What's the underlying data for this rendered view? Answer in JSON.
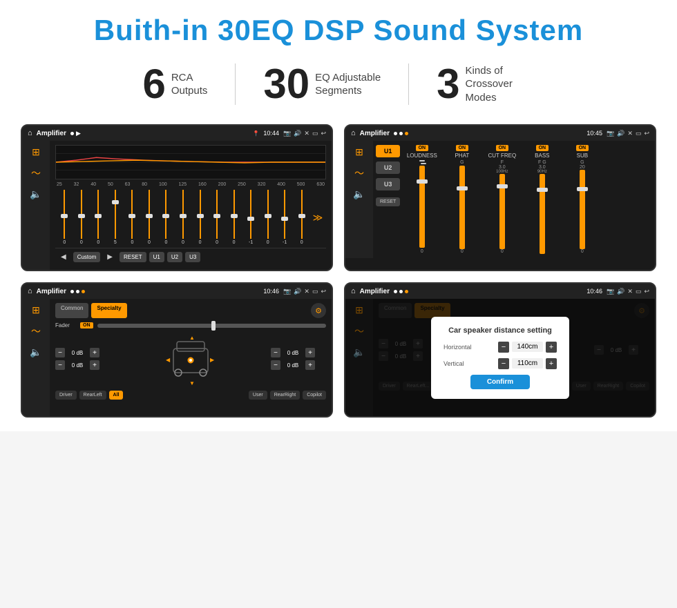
{
  "page": {
    "title": "Buith-in 30EQ DSP Sound System",
    "stats": [
      {
        "number": "6",
        "label": "RCA\nOutputs"
      },
      {
        "number": "30",
        "label": "EQ Adjustable\nSegments"
      },
      {
        "number": "3",
        "label": "Kinds of\nCrossover Modes"
      }
    ]
  },
  "screen1": {
    "topbar": {
      "title": "Amplifier",
      "time": "10:44",
      "mode": "▶"
    },
    "freqs": [
      "25",
      "32",
      "40",
      "50",
      "63",
      "80",
      "100",
      "125",
      "160",
      "200",
      "250",
      "320",
      "400",
      "500",
      "630"
    ],
    "values": [
      "0",
      "0",
      "0",
      "5",
      "0",
      "0",
      "0",
      "0",
      "0",
      "0",
      "0",
      "-1",
      "0",
      "-1"
    ],
    "buttons": [
      "Custom",
      "RESET",
      "U1",
      "U2",
      "U3"
    ]
  },
  "screen2": {
    "topbar": {
      "title": "Amplifier",
      "time": "10:45"
    },
    "uButtons": [
      "U1",
      "U2",
      "U3"
    ],
    "channels": [
      {
        "label": "LOUDNESS",
        "on": true
      },
      {
        "label": "PHAT",
        "on": true
      },
      {
        "label": "CUT FREQ",
        "on": true
      },
      {
        "label": "BASS",
        "on": true
      },
      {
        "label": "SUB",
        "on": true
      }
    ],
    "resetLabel": "RESET"
  },
  "screen3": {
    "topbar": {
      "title": "Amplifier",
      "time": "10:46"
    },
    "tabs": [
      "Common",
      "Specialty"
    ],
    "faderLabel": "Fader",
    "faderOn": "ON",
    "dbControls": [
      {
        "value": "0 dB"
      },
      {
        "value": "0 dB"
      },
      {
        "value": "0 dB"
      },
      {
        "value": "0 dB"
      }
    ],
    "bottomBtns": [
      "Driver",
      "RearLeft",
      "All",
      "User",
      "RearRight",
      "Copilot"
    ]
  },
  "screen4": {
    "topbar": {
      "title": "Amplifier",
      "time": "10:46"
    },
    "tabs": [
      "Common",
      "Specialty"
    ],
    "dialog": {
      "title": "Car speaker distance setting",
      "horizontal": {
        "label": "Horizontal",
        "value": "140cm"
      },
      "vertical": {
        "label": "Vertical",
        "value": "110cm"
      },
      "confirmLabel": "Confirm"
    },
    "dbControls": [
      {
        "value": "0 dB"
      },
      {
        "value": "0 dB"
      }
    ],
    "bottomBtns": [
      "Driver",
      "RearLeft",
      "All",
      "User",
      "RearRight",
      "Copilot"
    ]
  }
}
